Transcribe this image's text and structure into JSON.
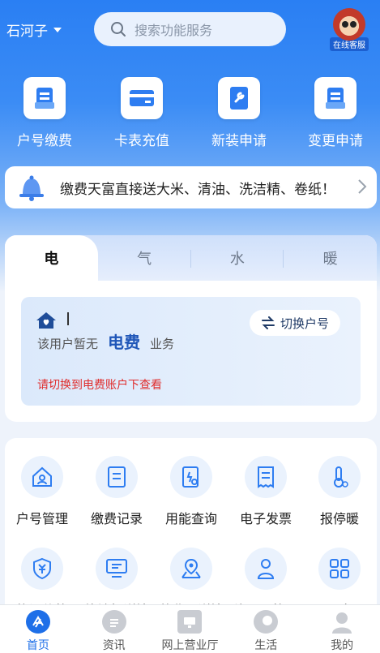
{
  "header": {
    "city": "石河子",
    "search_placeholder": "搜索功能服务",
    "customer_service_label": "在线客服"
  },
  "quick_actions": [
    {
      "label": "户号缴费",
      "icon": "bill-icon"
    },
    {
      "label": "卡表充值",
      "icon": "card-icon"
    },
    {
      "label": "新装申请",
      "icon": "wrench-doc-icon"
    },
    {
      "label": "变更申请",
      "icon": "change-doc-icon"
    }
  ],
  "notice": {
    "text": "缴费天富直接送大米、清油、洗洁精、卷纸！"
  },
  "utility": {
    "tabs": [
      "电",
      "气",
      "水",
      "暖"
    ],
    "active_tab": "电",
    "switch_label": "切换户号",
    "account_name": "I",
    "message_prefix": "该用户暂无",
    "message_service": "电费",
    "message_suffix": "业务",
    "warning": "请切换到电费账户下查看"
  },
  "services": [
    {
      "label": "户号管理",
      "icon": "house-user-icon"
    },
    {
      "label": "缴费记录",
      "icon": "record-icon"
    },
    {
      "label": "用能查询",
      "icon": "search-doc-icon"
    },
    {
      "label": "电子发票",
      "icon": "invoice-icon"
    },
    {
      "label": "报停暖",
      "icon": "thermometer-icon"
    },
    {
      "label": "能源价格",
      "icon": "price-shield-icon"
    },
    {
      "label": "终端机详情",
      "icon": "terminal-icon"
    },
    {
      "label": "营业厅详情",
      "icon": "map-pin-icon"
    },
    {
      "label": "片区网格员",
      "icon": "person-icon"
    },
    {
      "label": "更多",
      "icon": "grid-icon"
    }
  ],
  "bottom_nav": [
    {
      "label": "首页",
      "active": true
    },
    {
      "label": "资讯",
      "active": false
    },
    {
      "label": "网上营业厅",
      "active": false
    },
    {
      "label": "生活",
      "active": false
    },
    {
      "label": "我的",
      "active": false
    }
  ],
  "colors": {
    "primary": "#1e6fe8",
    "warning": "#e02c2c",
    "hero": "#2a7ff3"
  }
}
